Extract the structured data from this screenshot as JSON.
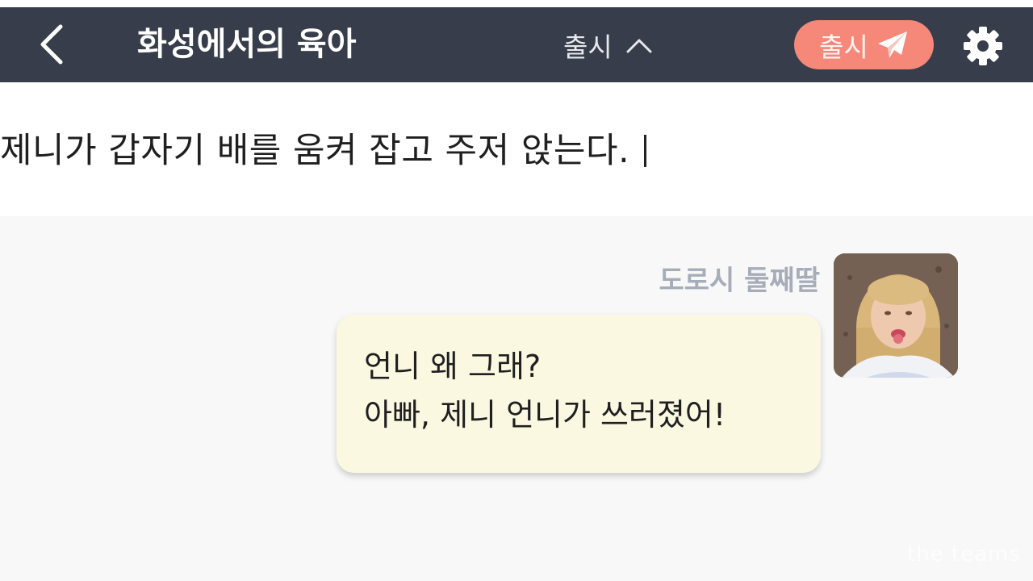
{
  "header": {
    "title": "화성에서의 육아",
    "mode_label": "출시",
    "publish_label": "출시"
  },
  "editor": {
    "text": "제니가 갑자기 배를 움켜 잡고 주저 앉는다."
  },
  "chat": {
    "speaker_name": "도로시 둘째딸",
    "messages": [
      "언니 왜 그래?",
      "아빠, 제니 언니가 쓰러졌어!"
    ]
  },
  "watermark": "the teams",
  "colors": {
    "header_bg": "#373d4a",
    "publish_bg": "#f6887a",
    "bubble_bg": "#fbf8e2",
    "speaker_name": "#a6adb8",
    "chat_bg": "#f8f8f9"
  },
  "icons": {
    "back": "chevron-left-icon",
    "mode": "chevron-up-icon",
    "publish": "paper-plane-icon",
    "settings": "gear-icon"
  }
}
